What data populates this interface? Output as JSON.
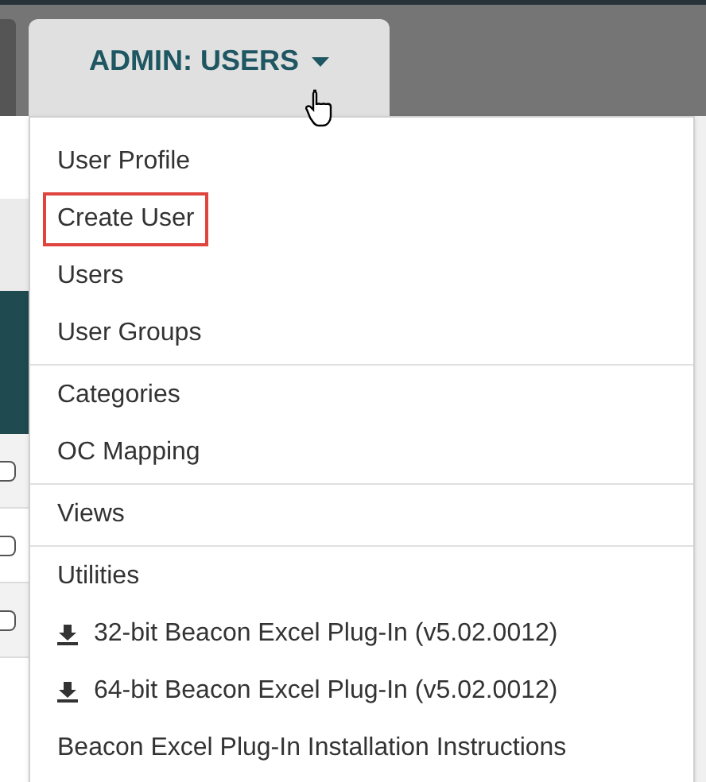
{
  "nav_tab": {
    "label": "ADMIN: USERS",
    "expanded": true
  },
  "menu": {
    "groups": [
      [
        {
          "label": "User Profile",
          "kind": "plain",
          "highlighted": false
        },
        {
          "label": "Create User",
          "kind": "plain",
          "highlighted": true
        },
        {
          "label": "Users",
          "kind": "plain",
          "highlighted": false
        },
        {
          "label": "User Groups",
          "kind": "plain",
          "highlighted": false
        }
      ],
      [
        {
          "label": "Categories",
          "kind": "plain",
          "highlighted": false
        },
        {
          "label": "OC Mapping",
          "kind": "plain",
          "highlighted": false
        }
      ],
      [
        {
          "label": "Views",
          "kind": "plain",
          "highlighted": false
        }
      ],
      [
        {
          "label": "Utilities",
          "kind": "plain",
          "highlighted": false
        },
        {
          "label": "32-bit Beacon Excel Plug-In (v5.02.0012)",
          "kind": "download",
          "highlighted": false
        },
        {
          "label": "64-bit Beacon Excel Plug-In (v5.02.0012)",
          "kind": "download",
          "highlighted": false
        },
        {
          "label": "Beacon Excel Plug-In Installation Instructions",
          "kind": "plain",
          "highlighted": false
        }
      ]
    ]
  },
  "table_rows": [
    {
      "checked": false
    },
    {
      "checked": false
    },
    {
      "checked": false
    }
  ]
}
